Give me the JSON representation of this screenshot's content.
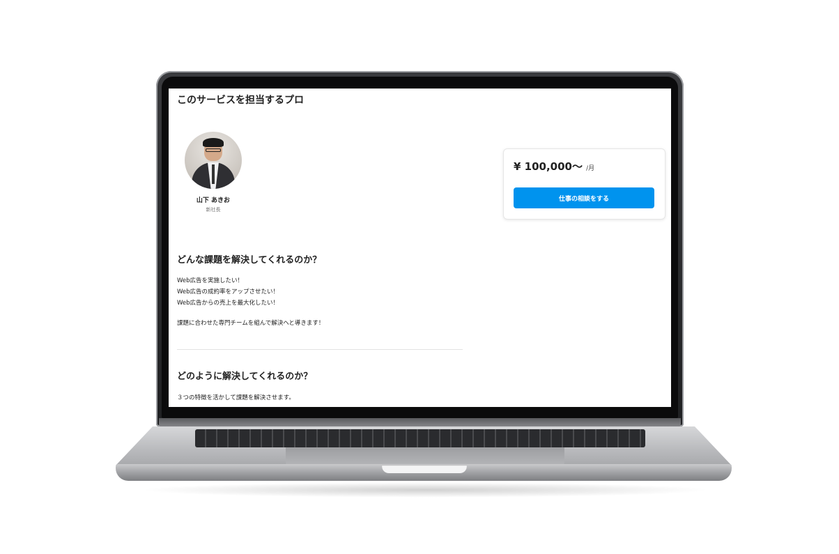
{
  "section_title": "このサービスを担当するプロ",
  "pro": {
    "name": "山下 あきお",
    "role": "新社長"
  },
  "pricing": {
    "amount": "¥ 100,000〜",
    "unit": "/月",
    "cta_label": "仕事の相談をする",
    "cta_color": "#0093ee"
  },
  "problem": {
    "heading": "どんな課題を解決してくれるのか？",
    "lines": [
      "Web広告を実施したい！",
      "Web広告の成約率をアップさせたい！",
      "Web広告からの売上を最大化したい！"
    ],
    "summary": "課題に合わせた専門チームを組んで解決へと導きます！"
  },
  "solution": {
    "heading": "どのように解決してくれるのか？",
    "intro": "３つの特徴を活かして課題を解決させます。"
  }
}
